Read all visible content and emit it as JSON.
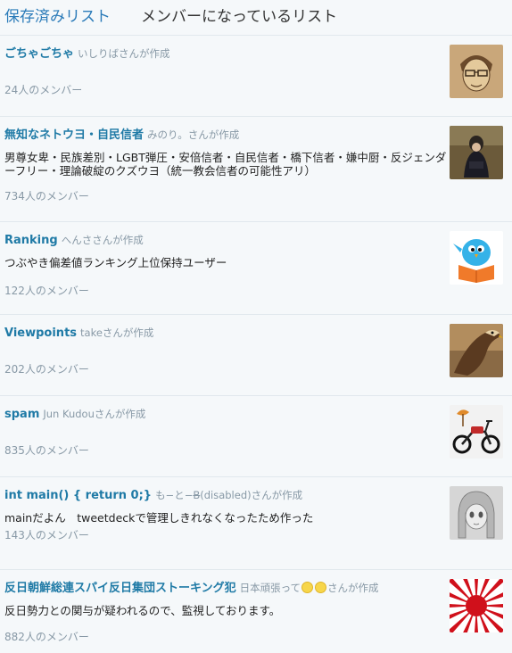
{
  "tabs": {
    "saved": "保存済みリスト",
    "member_of": "メンバーになっているリスト"
  },
  "lists": [
    {
      "name": "ごちゃごちゃ",
      "creator": "いしりばさんが作成",
      "description": "",
      "members": "24人のメンバー"
    },
    {
      "name": "無知なネトウヨ・自民信者",
      "creator": "みのり。さんが作成",
      "description": "男尊女卑・民族差別・LGBT弾圧・安倍信者・自民信者・橋下信者・嫌中厨・反ジェンダーフリー・理論破綻のクズウヨ（統一教会信者の可能性アリ）",
      "members": "734人のメンバー"
    },
    {
      "name": "Ranking",
      "creator": "へんささんが作成",
      "description": "つぶやき偏差値ランキング上位保持ユーザー",
      "members": "122人のメンバー"
    },
    {
      "name": "Viewpoints",
      "creator": "takeさんが作成",
      "description": "",
      "members": "202人のメンバー"
    },
    {
      "name": "spam",
      "creator": "Jun Kudouさんが作成",
      "description": "",
      "members": "835人のメンバー"
    },
    {
      "name": "int main() { return 0;}",
      "creator_prefix": "も−と−",
      "creator_strike": "B",
      "creator_suffix": "(disabled)さんが作成",
      "description": "mainだよん　tweetdeckで管理しきれなくなったため作った",
      "members": "143人のメンバー"
    },
    {
      "name": "反日朝鮮総連スパイ反日集団ストーキング犯",
      "creator_prefix": "日本頑張って",
      "creator_suffix": "さんが作成",
      "description": "反日勢力との関与が疑われるので、監視しております。",
      "members": "882人のメンバー"
    }
  ],
  "avatar_icons": [
    "face-sketch-avatar",
    "person-crouching-avatar",
    "blue-bird-reading-avatar",
    "eagle-avatar",
    "motorcycle-avatar",
    "anime-sketch-avatar",
    "rising-sun-flag-avatar"
  ]
}
